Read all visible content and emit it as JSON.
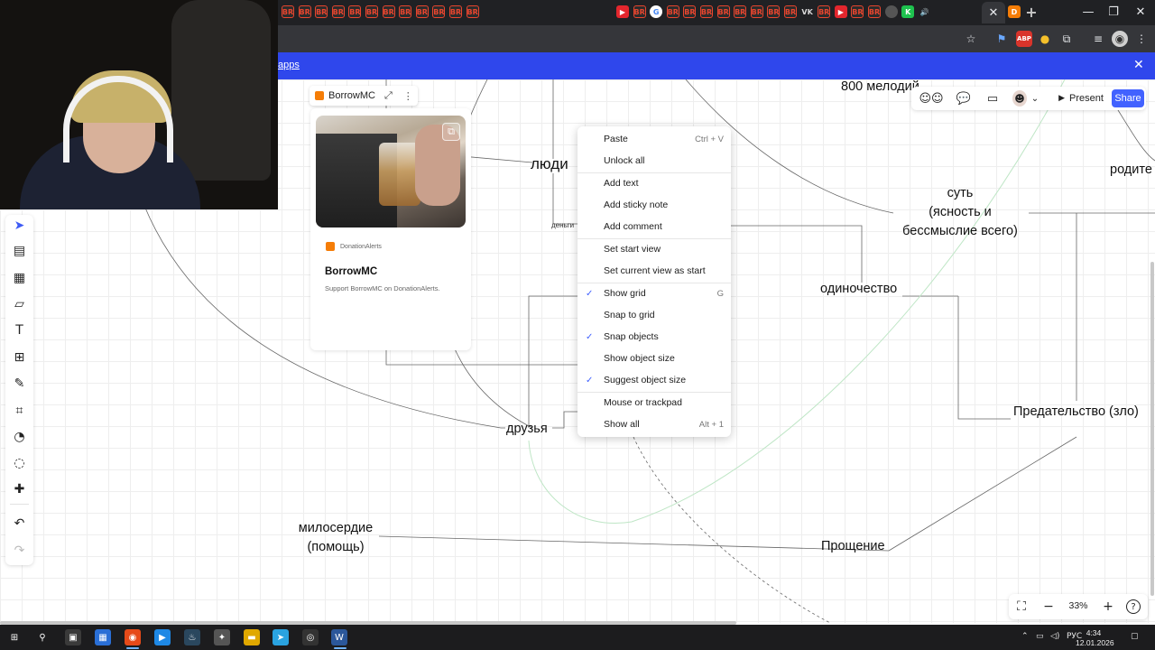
{
  "browser": {
    "tabs": [
      {
        "icon": "br-icon",
        "label": "BR"
      },
      {
        "icon": "br-icon",
        "label": "BR"
      },
      {
        "icon": "br-icon",
        "label": "BR"
      },
      {
        "icon": "br-icon",
        "label": "BR"
      },
      {
        "icon": "br-icon",
        "label": "BR"
      },
      {
        "icon": "br-icon",
        "label": "BR"
      },
      {
        "icon": "br-icon",
        "label": "BR"
      },
      {
        "icon": "br-icon",
        "label": "BR"
      },
      {
        "icon": "br-icon",
        "label": "BR"
      },
      {
        "icon": "br-icon",
        "label": "BR"
      },
      {
        "icon": "br-icon",
        "label": "BR"
      },
      {
        "icon": "br-icon",
        "label": "BR"
      },
      {
        "icon": "youtube-icon",
        "label": "▶"
      },
      {
        "icon": "br-icon",
        "label": "BR"
      },
      {
        "icon": "google-icon",
        "label": "G"
      },
      {
        "icon": "br-icon",
        "label": "BR"
      },
      {
        "icon": "br-icon",
        "label": "BR"
      },
      {
        "icon": "br-icon",
        "label": "BR"
      },
      {
        "icon": "br-icon",
        "label": "BR"
      },
      {
        "icon": "br-icon",
        "label": "BR"
      },
      {
        "icon": "br-icon",
        "label": "BR"
      },
      {
        "icon": "br-icon",
        "label": "BR"
      },
      {
        "icon": "br-icon",
        "label": "BR"
      },
      {
        "icon": "vk-icon",
        "label": "VK"
      },
      {
        "icon": "br-icon",
        "label": "BR"
      },
      {
        "icon": "youtube-icon",
        "label": "▶"
      },
      {
        "icon": "br-icon",
        "label": "BR"
      },
      {
        "icon": "br-icon",
        "label": "BR"
      },
      {
        "icon": "globe-icon",
        "label": ""
      },
      {
        "icon": "kick-icon",
        "label": "K"
      },
      {
        "icon": "speaker-icon",
        "label": "🔊"
      }
    ],
    "active_tab_close": "✕",
    "next_tab_icon": "D",
    "new_tab": "+",
    "window_controls": {
      "minimize": "—",
      "restore": "❐",
      "close": "✕"
    },
    "toolbar_icons": {
      "star": "☆",
      "abp": "ABP",
      "extensions": "⧉",
      "profile": "◉",
      "menu": "⋮"
    }
  },
  "banner": {
    "link_text": "apps",
    "close": "✕"
  },
  "embed": {
    "tag_label": "BorrowMC",
    "tag_expand": "⤢",
    "tag_more": "⋮",
    "brand": "DonationAlerts",
    "title": "BorrowMC",
    "description": "Support BorrowMC on DonationAlerts.",
    "open_icon": "⧉"
  },
  "mindmap": {
    "nodes": {
      "melodies": "800 мелодий",
      "people": "люди",
      "money": "деньги",
      "parents": "родите",
      "essence_1": "суть",
      "essence_2": "(ясность и",
      "essence_3": "бессмыслие всего)",
      "loneliness": "одиночество",
      "betrayal": "Предательство (зло)",
      "friends": "друзья",
      "mercy_1": "милосердие",
      "mercy_2": "(помощь)",
      "forgiveness": "Прощение"
    }
  },
  "context_menu": {
    "items": [
      {
        "label": "Paste",
        "shortcut": "Ctrl + V",
        "checked": false
      },
      {
        "label": "Unlock all",
        "shortcut": "",
        "checked": false
      },
      {
        "label": "Add text",
        "shortcut": "",
        "checked": false
      },
      {
        "label": "Add sticky note",
        "shortcut": "",
        "checked": false
      },
      {
        "label": "Add comment",
        "shortcut": "",
        "checked": false
      },
      {
        "label": "Set start view",
        "shortcut": "",
        "checked": false
      },
      {
        "label": "Set current view as start",
        "shortcut": "",
        "checked": false
      },
      {
        "label": "Show grid",
        "shortcut": "G",
        "checked": true
      },
      {
        "label": "Snap to grid",
        "shortcut": "",
        "checked": false
      },
      {
        "label": "Snap objects",
        "shortcut": "",
        "checked": true
      },
      {
        "label": "Show object size",
        "shortcut": "",
        "checked": false
      },
      {
        "label": "Suggest object size",
        "shortcut": "",
        "checked": true
      },
      {
        "label": "Mouse or trackpad",
        "shortcut": "",
        "checked": false
      },
      {
        "label": "Show all",
        "shortcut": "Alt + 1",
        "checked": false
      }
    ],
    "check_mark": "✓"
  },
  "topbar": {
    "reactions_icon": "☺☺",
    "chat_icon": "💬",
    "video_icon": "▭",
    "avatar_icon": "☻",
    "chevron": "⌄",
    "present_label": "Present",
    "present_icon": "▶",
    "share_label": "Share"
  },
  "tools": [
    {
      "name": "select-tool-icon",
      "glyph": "➤"
    },
    {
      "name": "templates-tool-icon",
      "glyph": "▤"
    },
    {
      "name": "layout-tool-icon",
      "glyph": "▦"
    },
    {
      "name": "sticky-note-tool-icon",
      "glyph": "▱"
    },
    {
      "name": "text-tool-icon",
      "glyph": "T"
    },
    {
      "name": "shapes-tool-icon",
      "glyph": "⊞"
    },
    {
      "name": "pen-tool-icon",
      "glyph": "✎"
    },
    {
      "name": "frame-tool-icon",
      "glyph": "⌗"
    },
    {
      "name": "palette-tool-icon",
      "glyph": "◔"
    },
    {
      "name": "comment-tool-icon",
      "glyph": "◌"
    },
    {
      "name": "add-more-tool-icon",
      "glyph": "✚"
    },
    {
      "name": "undo-icon",
      "glyph": "↶"
    },
    {
      "name": "redo-icon",
      "glyph": "↷"
    }
  ],
  "zoom": {
    "value": "33%",
    "fit_icon": "⛶",
    "minus": "−",
    "plus": "+",
    "help": "?"
  },
  "taskbar": {
    "apps": [
      {
        "name": "start-icon",
        "glyph": "⊞",
        "color": "#1c1c1e"
      },
      {
        "name": "search-icon",
        "glyph": "⚲",
        "color": "#1c1c1e"
      },
      {
        "name": "file-explorer-app-icon",
        "glyph": "▣",
        "color": "#3a3a3a"
      },
      {
        "name": "calculator-app-icon",
        "glyph": "▦",
        "color": "#2a6fd6"
      },
      {
        "name": "chrome-app-icon",
        "glyph": "◉",
        "color": "#e64a19"
      },
      {
        "name": "ide-app-icon",
        "glyph": "▶",
        "color": "#1e88e5"
      },
      {
        "name": "steam-app-icon",
        "glyph": "♨",
        "color": "#2a475e"
      },
      {
        "name": "wolf-app-icon",
        "glyph": "✦",
        "color": "#555"
      },
      {
        "name": "folder-app-icon",
        "glyph": "▬",
        "color": "#e0a800"
      },
      {
        "name": "telegram-app-icon",
        "glyph": "➤",
        "color": "#2aa3e0"
      },
      {
        "name": "obs-app-icon",
        "glyph": "◎",
        "color": "#333"
      },
      {
        "name": "word-app-icon",
        "glyph": "W",
        "color": "#2b579a"
      }
    ],
    "tray": {
      "chevron": "⌃",
      "keyboard_lang": "РУС"
    },
    "time": "4:34",
    "date": "12.01.2026"
  },
  "webcam": {
    "description_hidden": ""
  }
}
